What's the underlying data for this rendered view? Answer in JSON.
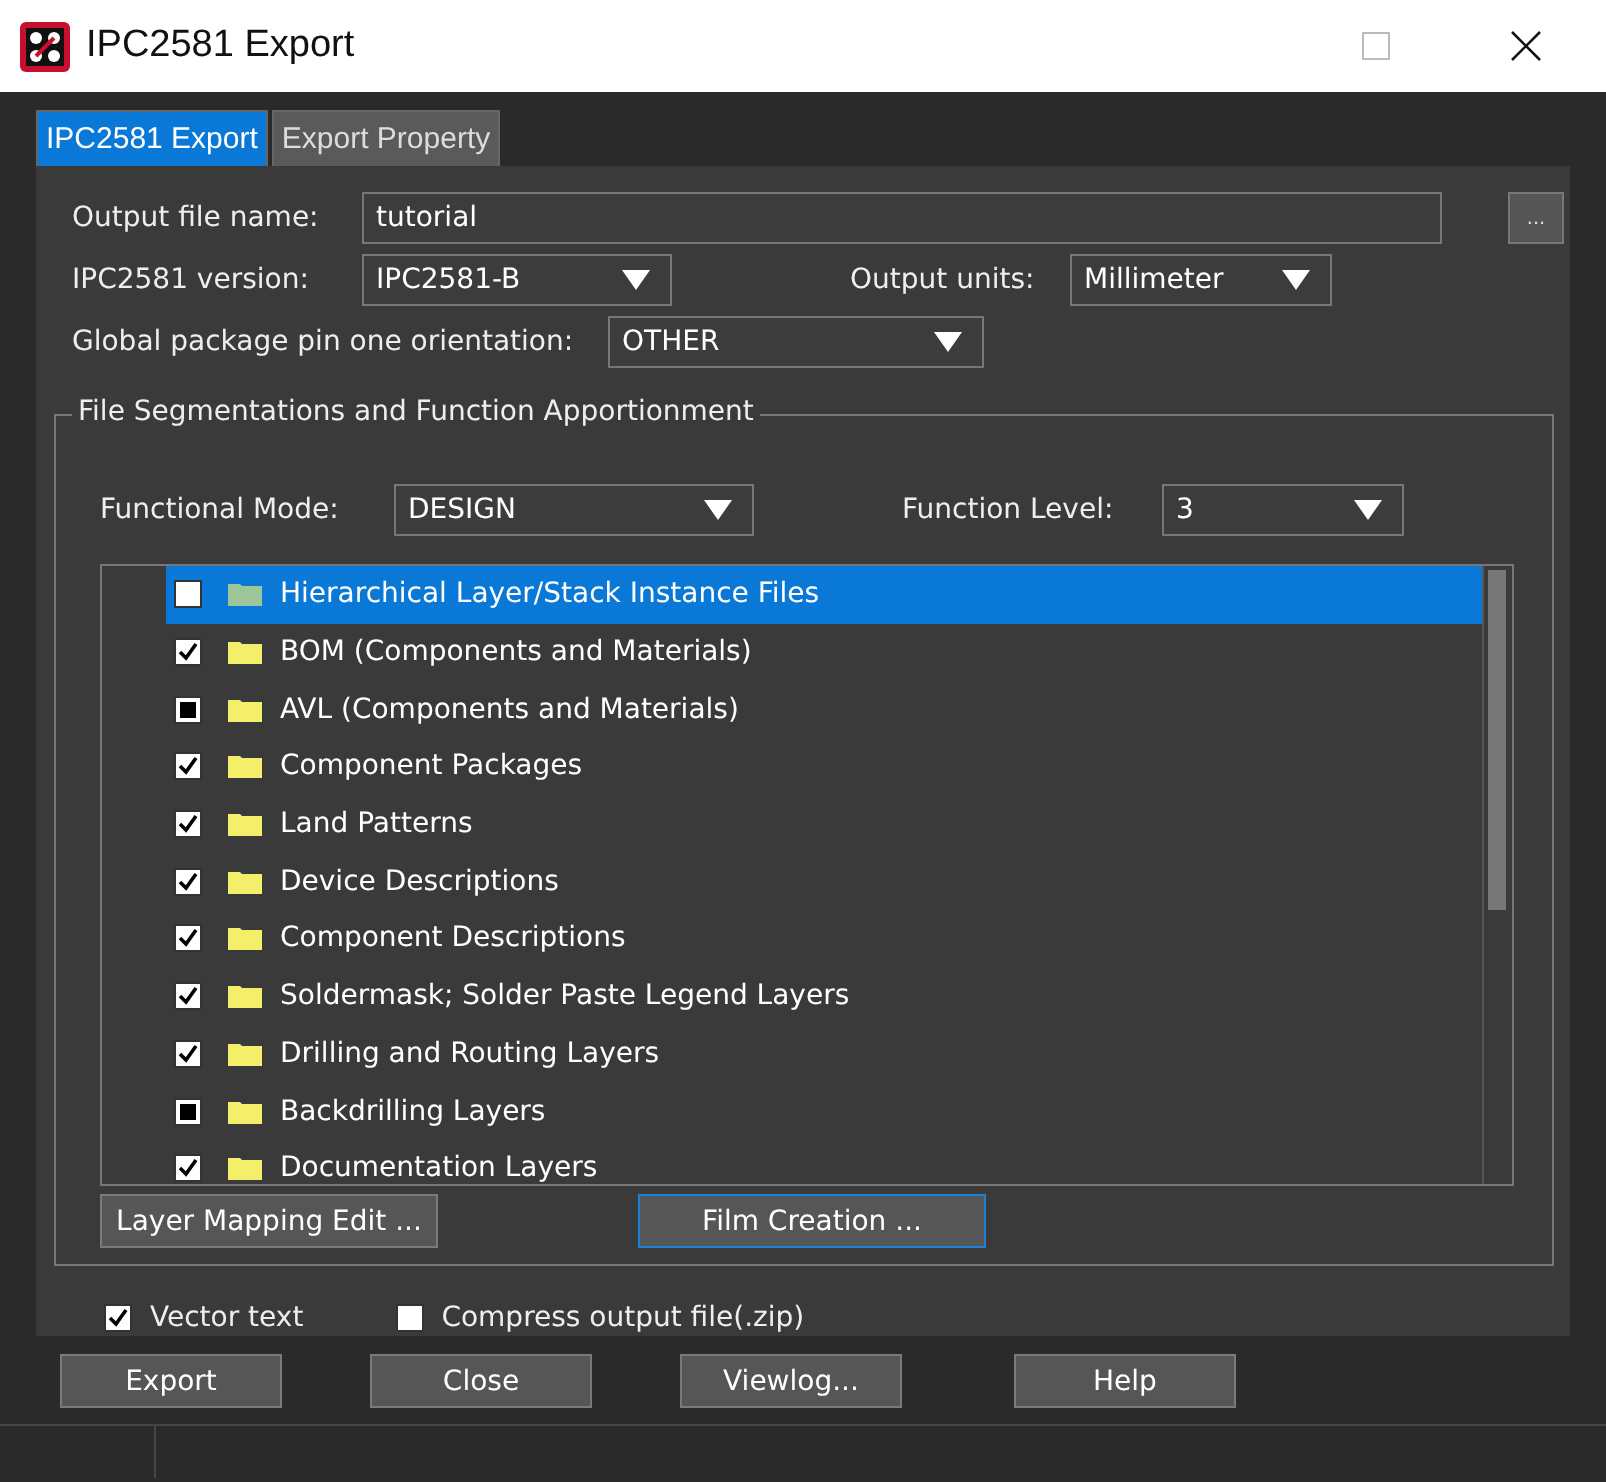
{
  "window": {
    "title": "IPC2581 Export"
  },
  "tabs": [
    {
      "label": "IPC2581 Export",
      "selected": true
    },
    {
      "label": "Export Property",
      "selected": false
    }
  ],
  "output_file_name": {
    "label": "Output file name:",
    "value": "tutorial",
    "browse": "..."
  },
  "version": {
    "label": "IPC2581 version:",
    "value": "IPC2581-B"
  },
  "output_units": {
    "label": "Output units:",
    "value": "Millimeter"
  },
  "pin_orientation": {
    "label": "Global package pin one orientation:",
    "value": "OTHER"
  },
  "group": {
    "title": "File Segmentations and Function Apportionment",
    "functional_mode": {
      "label": "Functional Mode:",
      "value": "DESIGN"
    },
    "function_level": {
      "label": "Function Level:",
      "value": "3"
    },
    "items": [
      {
        "label": "Hierarchical Layer/Stack Instance Files",
        "checked": false,
        "indeterminate": false,
        "selected": true
      },
      {
        "label": "BOM (Components and Materials)",
        "checked": true,
        "indeterminate": false,
        "selected": false
      },
      {
        "label": "AVL (Components and Materials)",
        "checked": false,
        "indeterminate": true,
        "selected": false
      },
      {
        "label": "Component Packages",
        "checked": true,
        "indeterminate": false,
        "selected": false
      },
      {
        "label": "Land Patterns",
        "checked": true,
        "indeterminate": false,
        "selected": false
      },
      {
        "label": "Device Descriptions",
        "checked": true,
        "indeterminate": false,
        "selected": false
      },
      {
        "label": "Component Descriptions",
        "checked": true,
        "indeterminate": false,
        "selected": false
      },
      {
        "label": "Soldermask; Solder Paste Legend Layers",
        "checked": true,
        "indeterminate": false,
        "selected": false
      },
      {
        "label": "Drilling and Routing Layers",
        "checked": true,
        "indeterminate": false,
        "selected": false
      },
      {
        "label": "Backdrilling Layers",
        "checked": false,
        "indeterminate": true,
        "selected": false
      },
      {
        "label": "Documentation Layers",
        "checked": true,
        "indeterminate": false,
        "selected": false
      }
    ],
    "buttons": [
      {
        "label": "Layer Mapping Edit ...",
        "focused": false
      },
      {
        "label": "Film Creation ...",
        "focused": true
      }
    ]
  },
  "options": [
    {
      "label": "Vector text",
      "checked": true
    },
    {
      "label": "Compress output file(.zip)",
      "checked": false
    }
  ],
  "buttons": [
    "Export",
    "Close",
    "Viewlog...",
    "Help"
  ]
}
